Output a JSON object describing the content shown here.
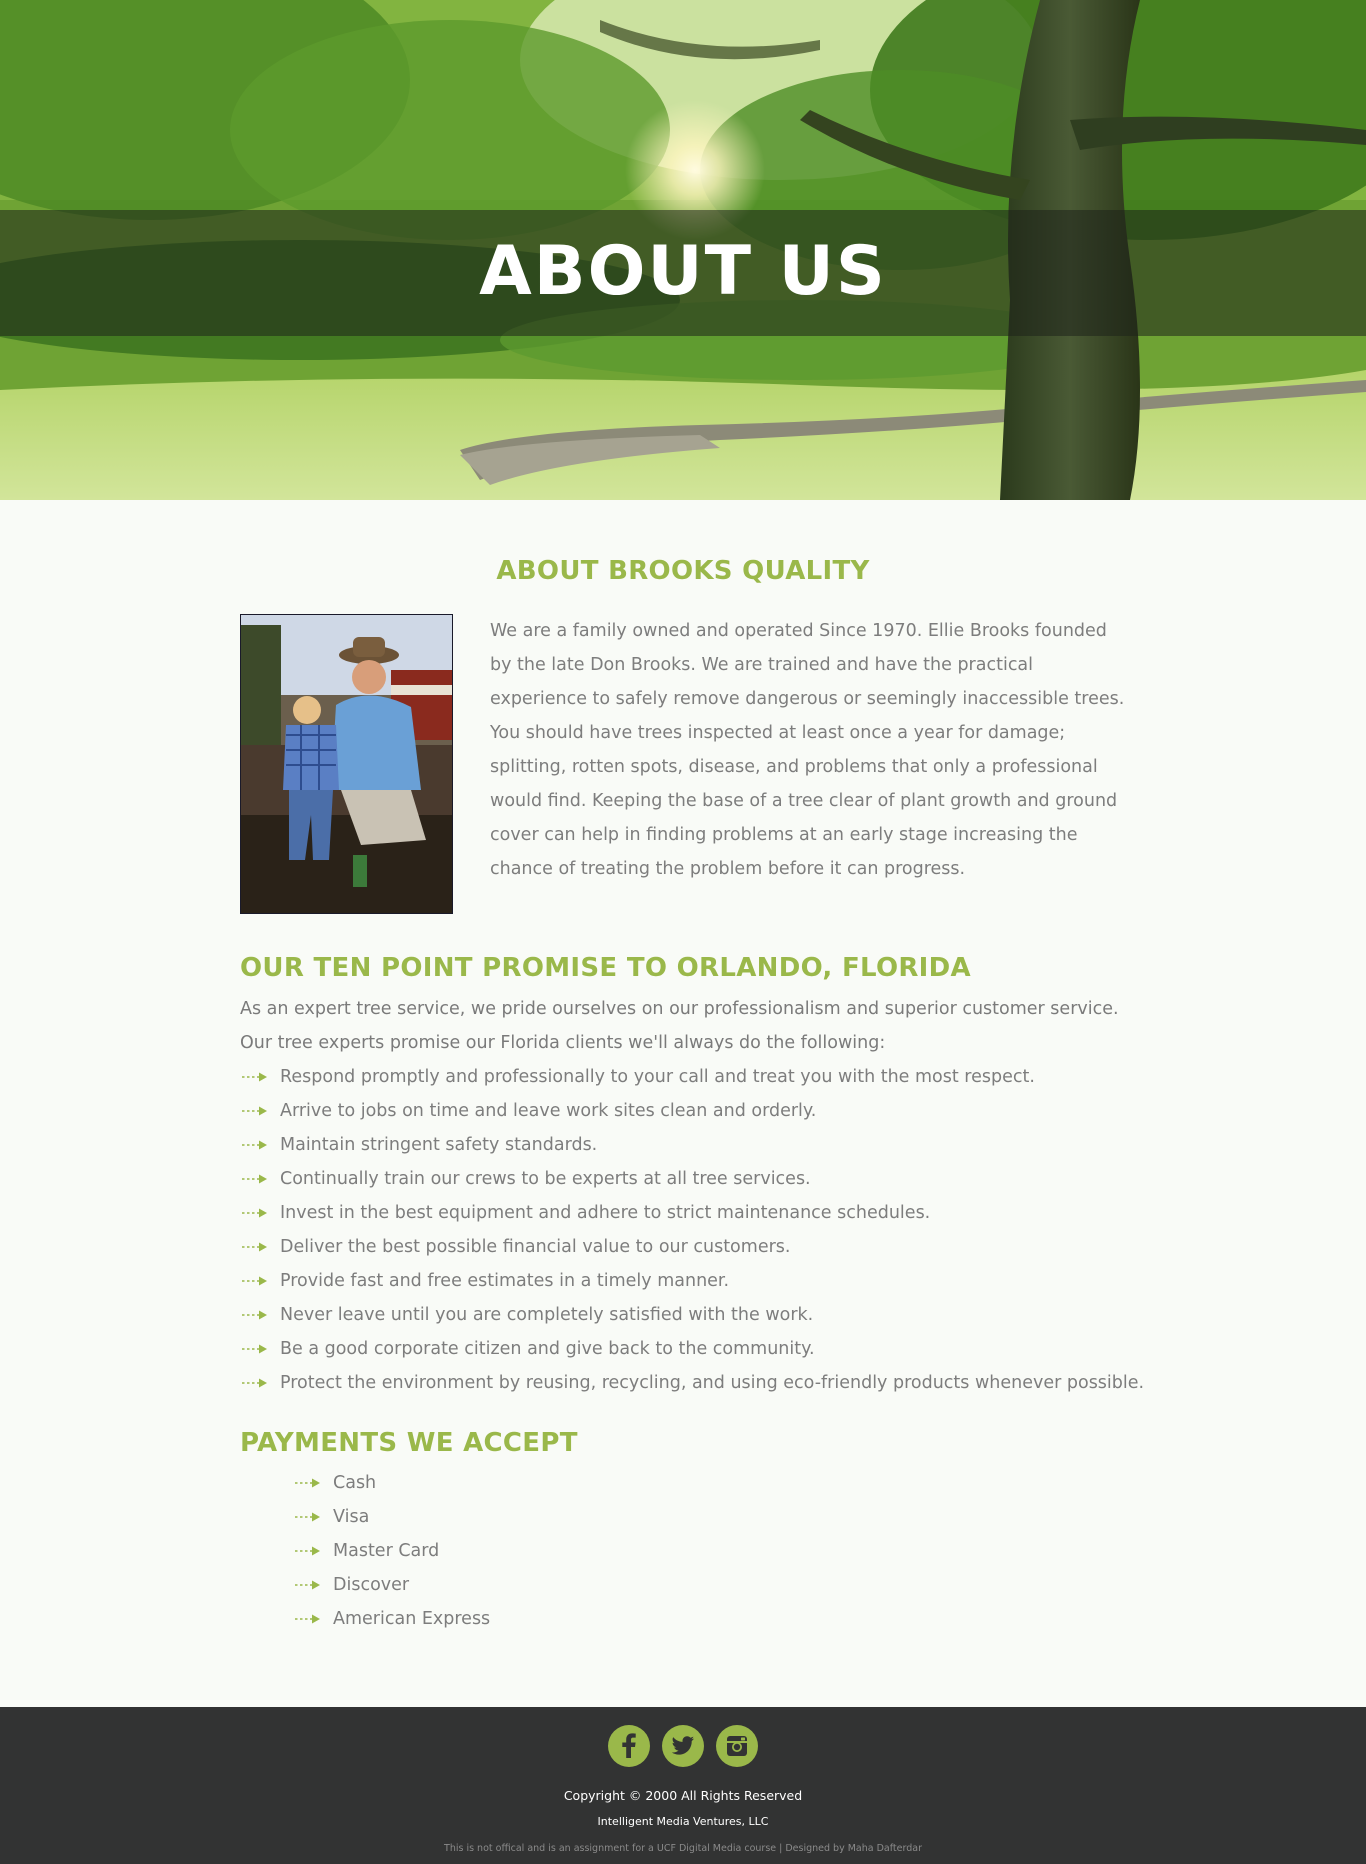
{
  "hero": {
    "title": "ABOUT US"
  },
  "about": {
    "title": "ABOUT BROOKS QUALITY",
    "body": "We are a family owned and operated Since 1970. Ellie Brooks founded by the late Don Brooks. We are trained and have the practical experience to safely remove dangerous or seemingly inaccessible trees. You should have trees inspected at least once a year for damage; splitting, rotten spots, disease, and problems that only a professional would find. Keeping the base of a tree clear of plant growth and ground cover can help in finding problems at an early stage increasing the chance of treating the problem before it can progress."
  },
  "promise": {
    "title": "OUR TEN POINT PROMISE TO ORLANDO, FLORIDA",
    "intro": "As an expert tree service, we pride ourselves on our professionalism and superior customer service. Our tree experts promise our Florida clients we'll always do the following:",
    "items": [
      "Respond promptly and professionally to your call and treat you with the most respect.",
      "Arrive to jobs on time and leave work sites clean and orderly.",
      "Maintain stringent safety standards.",
      "Continually train our crews to be experts at all tree services.",
      "Invest in the best equipment and adhere to strict maintenance schedules.",
      "Deliver the best possible financial value to our customers.",
      "Provide fast and free estimates in a timely manner.",
      "Never leave until you are completely satisfied with the work.",
      "Be a good corporate citizen and give back to the community.",
      "Protect the environment by reusing, recycling, and using eco-friendly products whenever possible."
    ]
  },
  "payments": {
    "title": "PAYMENTS WE ACCEPT",
    "items": [
      "Cash",
      "Visa",
      "Master Card",
      "Discover",
      "American Express"
    ]
  },
  "footer": {
    "social_icons": [
      "facebook-icon",
      "twitter-icon",
      "instagram-icon"
    ],
    "copyright": "Copyright © 2000 All Rights Reserved",
    "company": "Intelligent Media Ventures, LLC",
    "disclaimer": "This is not offical and is an assignment for a UCF Digital Media course | Designed by Maha Dafterdar"
  },
  "colors": {
    "accent": "#9ab84a",
    "text": "#7d7d7d",
    "footer_bg": "#323333",
    "page_bg": "#f9fbf7"
  }
}
